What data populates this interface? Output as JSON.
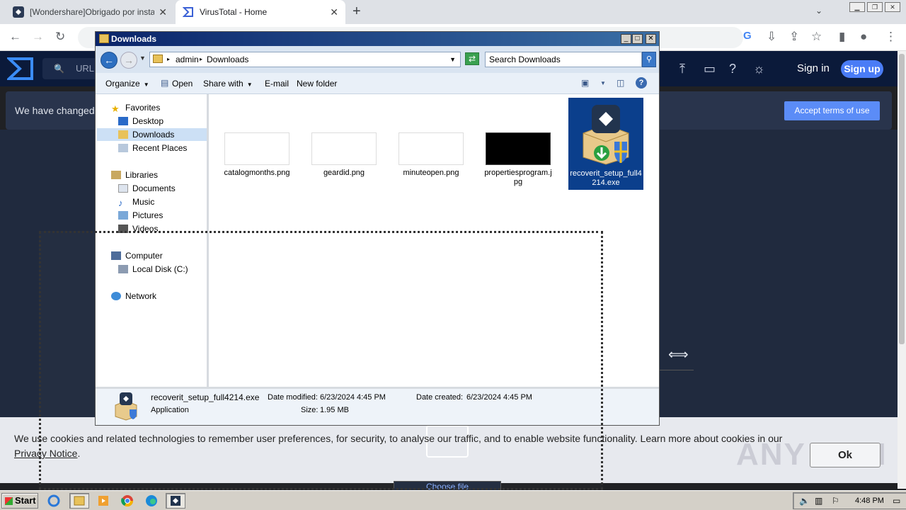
{
  "browser": {
    "tabs": [
      {
        "title": "[Wondershare]Obrigado por instalar",
        "icon": "wondershare-icon"
      },
      {
        "title": "VirusTotal - Home",
        "icon": "virustotal-icon"
      }
    ],
    "new_tab_label": "+"
  },
  "virustotal": {
    "search_placeholder": "URL",
    "sign_in": "Sign in",
    "sign_up": "Sign up",
    "banner_text": "We have changed o",
    "accept_terms": "Accept terms of use",
    "choose_file": "Choose file",
    "cookie_text_1": "We use cookies and related technologies to remember user preferences, for security, to analyse our traffic, and to enable website functionality. Learn more about cookies in our ",
    "cookie_link": "Privacy Notice",
    "cookie_text_2": ".",
    "ok": "Ok",
    "watermark": "ANY RUN"
  },
  "explorer": {
    "title": "Downloads",
    "breadcrumb": [
      "admin",
      "Downloads"
    ],
    "search_placeholder": "Search Downloads",
    "commands": {
      "organize": "Organize",
      "open": "Open",
      "share_with": "Share with",
      "email": "E-mail",
      "new_folder": "New folder"
    },
    "nav": {
      "favorites": "Favorites",
      "desktop": "Desktop",
      "downloads": "Downloads",
      "recent_places": "Recent Places",
      "libraries": "Libraries",
      "documents": "Documents",
      "music": "Music",
      "pictures": "Pictures",
      "videos": "Videos",
      "computer": "Computer",
      "local_disk": "Local Disk (C:)",
      "network": "Network"
    },
    "files": [
      {
        "name": "catalogmonths.png"
      },
      {
        "name": "geardid.png"
      },
      {
        "name": "minuteopen.png"
      },
      {
        "name": "propertiesprogram.jpg"
      },
      {
        "name": "recoverit_setup_full4214.exe"
      }
    ],
    "status": {
      "filename": "recoverit_setup_full4214.exe",
      "type": "Application",
      "modified_label": "Date modified:",
      "modified": "6/23/2024 4:45 PM",
      "created_label": "Date created:",
      "created": "6/23/2024 4:45 PM",
      "size_label": "Size:",
      "size": "1.95 MB"
    }
  },
  "taskbar": {
    "start": "Start",
    "clock": "4:48 PM"
  },
  "colors": {
    "vt_header": "#0b1a3a",
    "vt_accent": "#4a7cf6",
    "explorer_title": "#0a246a",
    "selection": "#0b3f8c"
  }
}
